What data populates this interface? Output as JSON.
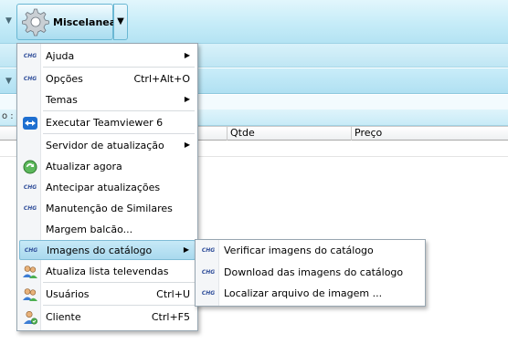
{
  "app": {
    "main_button_label": "Miscelanea",
    "info_text": "o : F",
    "grid_columns": [
      "Qtde",
      "Preço"
    ]
  },
  "menu": {
    "items": [
      {
        "label": "Ajuda",
        "shortcut": "",
        "icon": "chg-icon",
        "submenu": true
      },
      {
        "label": "Opções",
        "shortcut": "Ctrl+Alt+O",
        "icon": "chg-icon",
        "submenu": false
      },
      {
        "label": "Temas",
        "shortcut": "",
        "icon": "",
        "submenu": true
      },
      {
        "label": "Executar Teamviewer 6",
        "shortcut": "",
        "icon": "teamviewer-icon",
        "submenu": false
      },
      {
        "label": "Servidor de atualização",
        "shortcut": "",
        "icon": "",
        "submenu": true
      },
      {
        "label": "Atualizar agora",
        "shortcut": "",
        "icon": "update-globe-icon",
        "submenu": false
      },
      {
        "label": "Antecipar atualizações",
        "shortcut": "",
        "icon": "chg-icon",
        "submenu": false
      },
      {
        "label": "Manutenção de Similares",
        "shortcut": "",
        "icon": "chg-icon",
        "submenu": false
      },
      {
        "label": "Margem balcão...",
        "shortcut": "",
        "icon": "",
        "submenu": false
      },
      {
        "label": "Imagens do catálogo",
        "shortcut": "",
        "icon": "chg-icon",
        "submenu": true
      },
      {
        "label": "Atualiza lista televendas",
        "shortcut": "",
        "icon": "users-icon",
        "submenu": false
      },
      {
        "label": "Usuários",
        "shortcut": "Ctrl+U",
        "icon": "users-icon",
        "submenu": false
      },
      {
        "label": "Cliente",
        "shortcut": "Ctrl+F5",
        "icon": "client-icon",
        "submenu": false
      }
    ]
  },
  "submenu": {
    "items": [
      {
        "label": "Verificar imagens do catálogo",
        "icon": "chg-icon"
      },
      {
        "label": "Download das imagens do catálogo",
        "icon": "chg-icon"
      },
      {
        "label": "Localizar arquivo de imagem ...",
        "icon": "chg-icon"
      }
    ]
  },
  "icons": {
    "chg_text": "CHG"
  },
  "colors": {
    "toolbar": "#c6ecf8",
    "highlight": "#a9d9ee",
    "chg": "#2f4e9a"
  }
}
